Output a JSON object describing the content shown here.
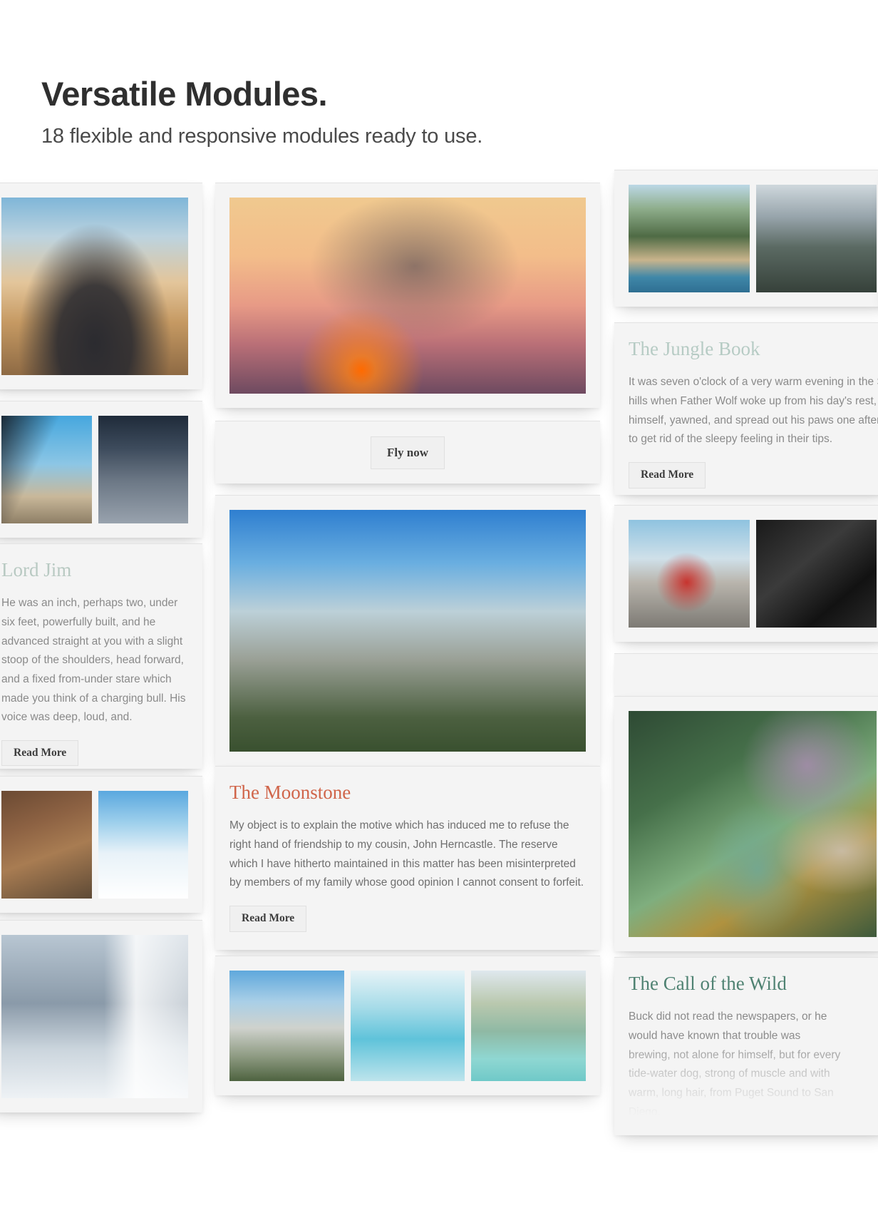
{
  "header": {
    "title": "Versatile Modules.",
    "subtitle": "18 flexible and responsive modules ready to use."
  },
  "buttons": {
    "read_more": "Read More",
    "fly_now": "Fly now"
  },
  "cards": {
    "lord_jim": {
      "title": "Lord Jim",
      "body": "He was an inch, perhaps two, under six feet, powerfully built, and he advanced straight at you with a slight stoop of the shoulders, head forward, and a fixed from-under stare which made you think of a charging bull. His voice was deep, loud, and.",
      "button": "Read More",
      "title_color": "#b8c9c2"
    },
    "jungle_book": {
      "title": "The Jungle Book",
      "body": "It was seven o'clock of a very warm evening in the Seeonee hills when Father Wolf woke up from his day's rest, scratched himself, yawned, and spread out his paws one after the other to get rid of the sleepy feeling in their tips.",
      "button": "Read More",
      "title_color": "#b6cbc4"
    },
    "moonstone": {
      "title": "The Moonstone",
      "body": "My object is to explain the motive which has induced me to refuse the right hand of friendship to my cousin, John Herncastle. The reserve which I have hitherto maintained in this matter has been misinterpreted by members of my family whose good opinion I cannot consent to forfeit.",
      "button": "Read More",
      "title_color": "#d0654a"
    },
    "call_of_the_wild": {
      "title": "The Call of the Wild",
      "body": "Buck did not read the newspapers, or he would have known that trouble was brewing, not alone for himself, but for every tide-water dog, strong of muscle and with warm, long hair, from Puget Sound to San Diego.",
      "title_color": "#4f8272"
    }
  },
  "images": {
    "heli_cockpit_city": "helicopter-cockpit-over-city",
    "heli_sunset": "helicopter-at-sunset",
    "heli_blade": "helicopter-rotor-blade",
    "city_aerial": "city-aerial-night",
    "desert_road": "desert-winding-road",
    "snow_pass": "snowy-mountain-pass",
    "window_mountain": "mountain-through-window",
    "halfdome": "half-dome-yosemite",
    "dolomites": "dolomites-peaks",
    "glacier": "blue-glacier-ice",
    "lagoon": "turquoise-mountain-lagoon",
    "thai_boat": "thailand-longtail-boat",
    "cliff_person": "person-on-cliff-edge",
    "red_heli": "red-helicopter-on-pad",
    "cockpit_bw": "black-and-white-cockpit",
    "succulents": "succulent-garden",
    "mountain_green": "green-mountain-ridge",
    "seaside": "turquoise-seaside"
  }
}
